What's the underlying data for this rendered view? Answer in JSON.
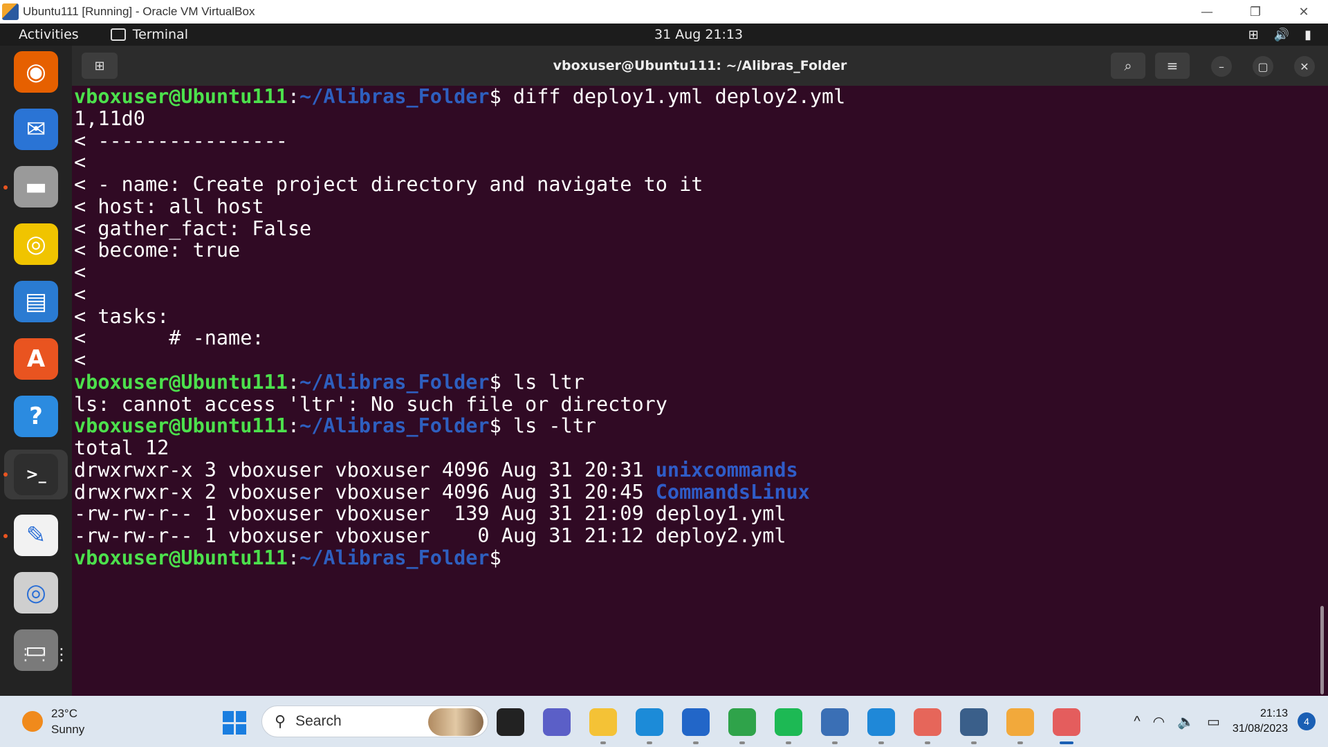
{
  "window": {
    "title": "Ubuntu111 [Running] - Oracle VM VirtualBox",
    "minimize_glyph": "—",
    "restore_glyph": "❐",
    "close_glyph": "✕"
  },
  "gnome_bar": {
    "activities": "Activities",
    "app_name": "Terminal",
    "clock": "31 Aug 21:13",
    "network_glyph": "⊞",
    "volume_glyph": "🔊",
    "battery_glyph": "▮"
  },
  "terminal": {
    "title": "vboxuser@Ubuntu111: ~/Alibras_Folder",
    "new_tab_glyph": "⊞",
    "search_glyph": "⌕",
    "menu_glyph": "≡",
    "minimize_glyph": "–",
    "maximize_glyph": "▢",
    "close_glyph": "✕",
    "user_host": "vboxuser@Ubuntu111",
    "colon": ":",
    "path": "~/Alibras_Folder",
    "prompt_symbol": "$",
    "cmd1": " diff deploy1.yml deploy2.yml",
    "diff_lines": [
      "1,11d0",
      "< ----------------",
      "<",
      "< - name: Create project directory and navigate to it",
      "< host: all host",
      "< gather_fact: False",
      "< become: true",
      "<",
      "<",
      "< tasks:",
      "<       # -name:",
      "<"
    ],
    "cmd2": " ls ltr",
    "error_line": "ls: cannot access 'ltr': No such file or directory",
    "cmd3": " ls -ltr",
    "total_line": "total 12",
    "listing": [
      {
        "meta": "drwxrwxr-x 3 vboxuser vboxuser 4096 Aug 31 20:31 ",
        "name": "unixcommands"
      },
      {
        "meta": "drwxrwxr-x 2 vboxuser vboxuser 4096 Aug 31 20:45 ",
        "name": "CommandsLinux"
      },
      {
        "meta": "-rw-rw-r-- 1 vboxuser vboxuser  139 Aug 31 21:09 ",
        "name": "deploy1.yml"
      },
      {
        "meta": "-rw-rw-r-- 1 vboxuser vboxuser    0 Aug 31 21:12 ",
        "name": "deploy2.yml"
      }
    ]
  },
  "dock": {
    "items": [
      {
        "name": "firefox-icon",
        "color": "#e66000",
        "glyph": "◉"
      },
      {
        "name": "thunderbird-icon",
        "color": "#2a74d5",
        "glyph": "✉"
      },
      {
        "name": "files-icon",
        "color": "#9a9a9a",
        "glyph": "▬"
      },
      {
        "name": "rhythmbox-icon",
        "color": "#f0c400",
        "glyph": "◎"
      },
      {
        "name": "writer-icon",
        "color": "#2a7bd2",
        "glyph": "▤"
      },
      {
        "name": "app-center-icon",
        "color": "#e95420",
        "glyph": "A"
      },
      {
        "name": "help-icon",
        "color": "#2b8be0",
        "glyph": "?"
      },
      {
        "name": "terminal-icon",
        "color": "#2e2e2e",
        "glyph": ">_"
      },
      {
        "name": "text-editor-icon",
        "color": "#f2f2f2",
        "glyph": "✎"
      },
      {
        "name": "disc-icon",
        "color": "#cfcfcf",
        "glyph": "◎"
      },
      {
        "name": "drive-icon",
        "color": "#7a7a7a",
        "glyph": "▭"
      }
    ],
    "grid_glyph": "⋮⋮⋮"
  },
  "taskbar": {
    "temperature": "23°C",
    "condition": "Sunny",
    "search_label": "Search",
    "search_glyph": "⚲",
    "time": "21:13",
    "date": "31/08/2023",
    "notification_count": "4",
    "chevron_glyph": "^",
    "wifi_glyph": "◠",
    "speaker_glyph": "🔈",
    "battery_glyph": "▭",
    "apps": [
      {
        "name": "task-view-icon",
        "color": "#222222"
      },
      {
        "name": "teams-icon",
        "color": "#5b5fc7"
      },
      {
        "name": "file-explorer-icon",
        "color": "#f4c236"
      },
      {
        "name": "edge-icon",
        "color": "#1c8bd8"
      },
      {
        "name": "store-icon",
        "color": "#2266c8"
      },
      {
        "name": "chrome-icon",
        "color": "#2fa34a"
      },
      {
        "name": "spotify-icon",
        "color": "#1db954"
      },
      {
        "name": "slack-icon",
        "color": "#3a6fb5"
      },
      {
        "name": "vscode-icon",
        "color": "#1f88d8"
      },
      {
        "name": "git-icon",
        "color": "#e6665a"
      },
      {
        "name": "virtualbox-icon",
        "color": "#3a5f8a"
      },
      {
        "name": "notes-icon",
        "color": "#f2a93b"
      },
      {
        "name": "snipping-tool-icon",
        "color": "#e45d5d"
      }
    ]
  }
}
